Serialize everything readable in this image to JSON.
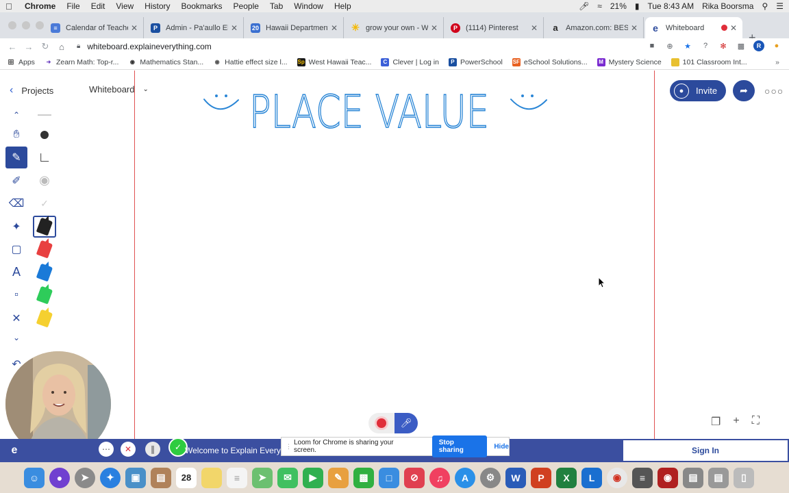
{
  "menubar": {
    "app": "Chrome",
    "items": [
      "File",
      "Edit",
      "View",
      "History",
      "Bookmarks",
      "People",
      "Tab",
      "Window",
      "Help"
    ],
    "battery": "21%",
    "clock": "Tue 8:43 AM",
    "user": "Rika Boorsma"
  },
  "tabs": [
    {
      "title": "Calendar of Teacher",
      "color": "#4a7ad8"
    },
    {
      "title": "Admin - Pa'aullo Ele",
      "color": "#1a4fa0",
      "glyph": "P"
    },
    {
      "title": "Hawaii Department o",
      "color": "#3a6fd0",
      "glyph": "20"
    },
    {
      "title": "grow your own - Wal",
      "color": "#f5b800"
    },
    {
      "title": "(1114) Pinterest",
      "color": "#d0021b",
      "glyph": "P"
    },
    {
      "title": "Amazon.com: BEST",
      "color": "#222",
      "glyph": "a"
    },
    {
      "title": "Whiteboard",
      "color": "#2c4a9c",
      "glyph": "e"
    }
  ],
  "address": "whiteboard.explaineverything.com",
  "bookmarks": [
    {
      "label": "Apps",
      "color": "#555"
    },
    {
      "label": "Zearn Math: Top-r...",
      "color": "#6b3fc0"
    },
    {
      "label": "Mathematics Stan...",
      "color": "#333"
    },
    {
      "label": "Hattie effect size l...",
      "color": "#555"
    },
    {
      "label": "West Hawaii Teac...",
      "color": "#1a1a1a",
      "glyph": "Sp"
    },
    {
      "label": "Clever | Log in",
      "color": "#3b5fd8",
      "glyph": "C"
    },
    {
      "label": "PowerSchool",
      "color": "#1a4fa0",
      "glyph": "P"
    },
    {
      "label": "eSchool Solutions...",
      "color": "#e86020",
      "glyph": "SF"
    },
    {
      "label": "Mystery Science",
      "color": "#7a2bd0",
      "glyph": "M"
    },
    {
      "label": "101 Classroom Int...",
      "color": "#e8c030"
    }
  ],
  "whiteboard": {
    "projects_label": "Projects",
    "board_name": "Whiteboard",
    "canvas_title": "PLACE VALUE",
    "invite_label": "Invite"
  },
  "bottom": {
    "welcome": "Welcome to Explain Every",
    "signin": "Sign In",
    "loom_message": "Loom for Chrome is sharing your screen.",
    "stop_sharing": "Stop sharing",
    "hide": "Hide"
  },
  "dock": [
    {
      "name": "finder",
      "color": "#3a8de0"
    },
    {
      "name": "siri",
      "color": "#7040d0"
    },
    {
      "name": "launchpad",
      "color": "#8a8a8a"
    },
    {
      "name": "safari",
      "color": "#2a80e0"
    },
    {
      "name": "preview",
      "color": "#4a90c8"
    },
    {
      "name": "notes-box",
      "color": "#b0825a"
    },
    {
      "name": "calendar",
      "color": "#ffffff",
      "glyph": "28"
    },
    {
      "name": "stickies",
      "color": "#f2d66a"
    },
    {
      "name": "reminders",
      "color": "#f4f4f4"
    },
    {
      "name": "maps",
      "color": "#6cc070"
    },
    {
      "name": "messages",
      "color": "#40c060"
    },
    {
      "name": "facetime",
      "color": "#30b050"
    },
    {
      "name": "keynote-like",
      "color": "#e8a040"
    },
    {
      "name": "numbers",
      "color": "#30b040"
    },
    {
      "name": "keynote",
      "color": "#3a8de0"
    },
    {
      "name": "news",
      "color": "#e04050"
    },
    {
      "name": "music",
      "color": "#f04060"
    },
    {
      "name": "app-store",
      "color": "#2a90e8"
    },
    {
      "name": "system-preferences",
      "color": "#888"
    },
    {
      "name": "word",
      "color": "#2a5cb8",
      "glyph": "W"
    },
    {
      "name": "powerpoint",
      "color": "#d04020",
      "glyph": "P"
    },
    {
      "name": "excel",
      "color": "#20803f",
      "glyph": "X"
    },
    {
      "name": "lync",
      "color": "#1a6fd0",
      "glyph": "L"
    },
    {
      "name": "chrome",
      "color": "#e8e8e8"
    },
    {
      "name": "calculator",
      "color": "#555"
    },
    {
      "name": "photo-booth",
      "color": "#b02020"
    },
    {
      "name": "downloads",
      "color": "#888"
    },
    {
      "name": "documents",
      "color": "#999"
    },
    {
      "name": "trash",
      "color": "#bbb"
    }
  ]
}
